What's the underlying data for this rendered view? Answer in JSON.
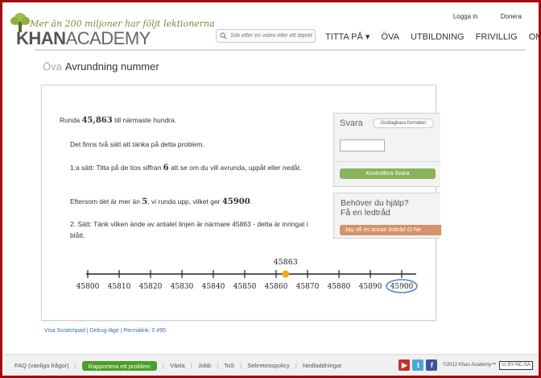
{
  "header": {
    "tagline": "Mer än 200 miljoner har följt lektionerna",
    "logo_bold": "KHAN",
    "logo_regular": "ACADEMY",
    "search_placeholder": "Sök efter en video eller ett objekt",
    "login": "Logga in",
    "donate": "Donera",
    "nav": [
      "TITTA PÅ ▾",
      "ÖVA",
      "UTBILDNING",
      "FRIVILLIG",
      "OM"
    ]
  },
  "page": {
    "title_prefix": "Öva",
    "title": "Avrundning nummer"
  },
  "problem": {
    "prefix": "Runda",
    "number": "45,863",
    "suffix": "till närmaste hundra.",
    "hints": [
      "Det finns två sätt att tänka på detta problem.",
      "1:a sätt: Titta på de tios siffran",
      "att se om du vill avrunda, uppåt eller nedåt.",
      "Eftersom det är mer än",
      ", vi runda upp, vilket ger",
      "2. Sätt: Tänk vilken ände av antalet linjen är närmare 45863 - detta är inringat i blått."
    ],
    "tens_digit": "6",
    "threshold": "5",
    "result": "45900"
  },
  "number_line": {
    "marked_value": "45863",
    "marked_value_number": 45863,
    "ticks": [
      "45800",
      "45810",
      "45820",
      "45830",
      "45840",
      "45850",
      "45860",
      "45870",
      "45880",
      "45890",
      "45900"
    ],
    "circled_tick": "45900",
    "marker_color": "#f5a623",
    "circle_color": "#4a86d4"
  },
  "answer": {
    "title": "Svara",
    "format_button": "Godtagbara formaten",
    "input_value": "",
    "check_button": "Kontrollera Svara"
  },
  "help": {
    "title_line1": "Behöver du hjälp?",
    "title_line2": "Få en ledtråd",
    "hint_button": "Jag vill en annan ledtråd (0 Ne"
  },
  "bottom_links": {
    "scratchpad": "Visa Scratchpad",
    "debug": "Debug-läge",
    "permalink": "Permalink: 0 #95"
  },
  "footer": {
    "faq": "FAQ (vanliga frågor)",
    "report": "Rapportera ett problem",
    "links": [
      "Växla",
      "Jobb",
      "ToS",
      "Sekretesspolicy",
      "Nedladdningar"
    ],
    "copyright": "©2012 Khan Academy™",
    "license": "BY-NC-SA"
  },
  "colors": {
    "frame": "#a30d0d",
    "check_button": "#89b35c",
    "hint_button": "#d4916a",
    "report_button": "#4c9e28",
    "link": "#3b6db5"
  }
}
